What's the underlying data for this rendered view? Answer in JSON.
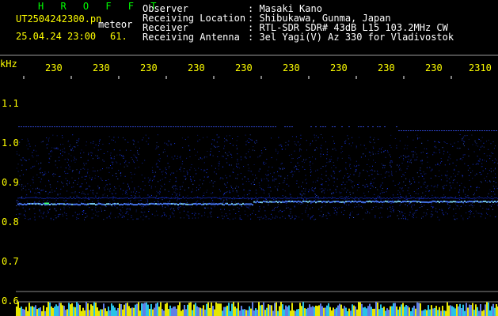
{
  "app": {
    "name": "H R O F F T",
    "filename": "UT2504242300.pn",
    "mode": "meteor",
    "datetime": "25.04.24 23:00",
    "count": "61."
  },
  "info": {
    "labels": [
      "Observer",
      "Receiving Location",
      "Receiver",
      "Receiving Antenna"
    ],
    "values": [
      ": Masaki Kano",
      ": Shibukawa, Gunma, Japan",
      ": RTL-SDR SDR# 43dB L15 103.2MHz CW",
      ": 3el Yagi(V) Az 330 for Vladivostok"
    ]
  },
  "axis": {
    "unit": "kHz",
    "y_ticks": [
      "1.1",
      "1.0",
      "0.9",
      "0.8",
      "0.7",
      "0.6"
    ],
    "time_labels": [
      "230",
      "230",
      "230",
      "230",
      "230",
      "230",
      "230",
      "230",
      "230",
      "2310"
    ]
  },
  "colors": {
    "background": "#000000",
    "text_white": "#ffffff",
    "text_yellow": "#ffff00",
    "title_green": "#00ff00",
    "signal_blue": "#1a3aff",
    "trace_cyan": "#7fd8ff",
    "trace_green": "#3cff6a",
    "activity_yellow": "#ffff00"
  },
  "signals": {
    "main_trace_khz": 0.845,
    "upper_trace_khz": 1.04,
    "noise_band_khz": [
      0.82,
      1.0
    ]
  }
}
